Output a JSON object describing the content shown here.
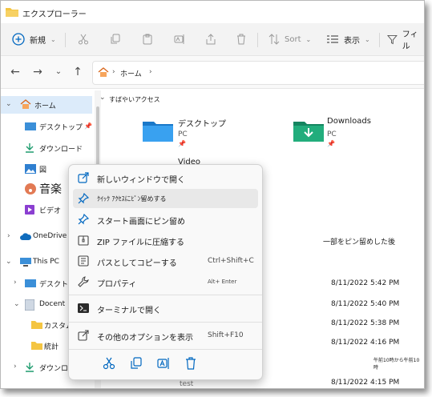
{
  "window": {
    "title": "エクスプローラー"
  },
  "toolbar": {
    "new_label": "新規",
    "sort_label": "Sort",
    "view_label": "表示",
    "filter_label": "フィル"
  },
  "address": {
    "crumbs": [
      "ホーム"
    ]
  },
  "sidebar": {
    "items": [
      {
        "label": "ホーム"
      },
      {
        "label": "デスクトップ"
      },
      {
        "label": "ダウンロード"
      },
      {
        "label": "図"
      },
      {
        "label": "音楽"
      },
      {
        "label": "ビデオ"
      },
      {
        "label": "OneDrive"
      },
      {
        "label": "This PC"
      },
      {
        "label": "デスクトップ"
      },
      {
        "label": "Docent"
      },
      {
        "label": "カスタム"
      },
      {
        "label": "統計"
      },
      {
        "label": "ダウンロード"
      }
    ]
  },
  "content": {
    "quick_access_header": "すばやいアクセス",
    "tiles": [
      {
        "name": "デスクトップ",
        "sub": "PC"
      },
      {
        "name": "Downloads",
        "sub": "PC"
      },
      {
        "name": "Video"
      }
    ],
    "pinned_note": "一部をピン留めした後",
    "dates": [
      "8/11/2022 5:42 PM",
      "8/11/2022 5:40 PM",
      "8/11/2022 5:38 PM",
      "8/11/2022 4:16 PM",
      "8/11/2022 4:15 PM"
    ],
    "overlap_note": "午前10時から午前10時",
    "partial_file": "test"
  },
  "context_menu": {
    "items": [
      {
        "label": "新しいウィンドウで開く",
        "icon": "open-new-window-icon"
      },
      {
        "label": "ｸｲｯｸ ｱｸｾｽにﾋﾟﾝ留めする",
        "icon": "pin-icon"
      },
      {
        "label": "スタート画面にピン留め",
        "icon": "pin-icon"
      },
      {
        "label": "ZIP ファイルに圧縮する",
        "icon": "zip-icon"
      },
      {
        "label": "パスとしてコピーする",
        "icon": "copy-path-icon",
        "shortcut": "Ctrl+Shift+C"
      },
      {
        "label": "プロパティ",
        "icon": "wrench-icon",
        "shortcut": "Alt+ Enter"
      },
      {
        "label": "ターミナルで開く",
        "icon": "terminal-icon"
      },
      {
        "label": "その他のオプションを表示",
        "icon": "more-options-icon",
        "shortcut": "Shift+F10"
      }
    ],
    "bottom_icons": [
      "cut-icon",
      "copy-icon",
      "rename-icon",
      "delete-icon"
    ]
  },
  "colors": {
    "accent": "#0067c0",
    "folder": "#f4c542",
    "selected": "#dcebfa",
    "download_folder": "#1f9c6f"
  }
}
